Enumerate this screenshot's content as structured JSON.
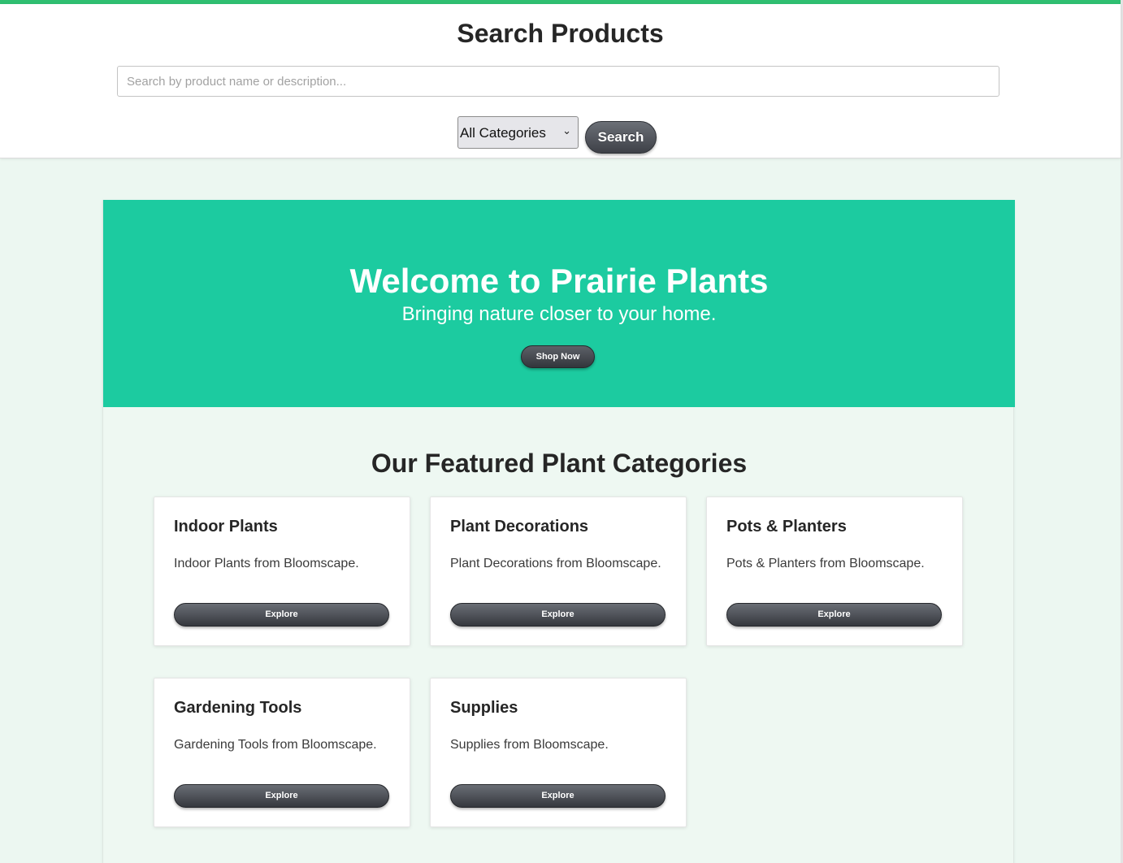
{
  "search": {
    "title": "Search Products",
    "placeholder": "Search by product name or description...",
    "category_selected": "All Categories",
    "button_label": "Search"
  },
  "hero": {
    "title": "Welcome to Prairie Plants",
    "subtitle": "Bringing nature closer to your home.",
    "button_label": "Shop Now"
  },
  "featured": {
    "title": "Our Featured Plant Categories",
    "cards": [
      {
        "title": "Indoor Plants",
        "description": "Indoor Plants from Bloomscape.",
        "button_label": "Explore"
      },
      {
        "title": "Plant Decorations",
        "description": "Plant Decorations from Bloomscape.",
        "button_label": "Explore"
      },
      {
        "title": "Pots & Planters",
        "description": "Pots & Planters from Bloomscape.",
        "button_label": "Explore"
      },
      {
        "title": "Gardening Tools",
        "description": "Gardening Tools from Bloomscape.",
        "button_label": "Explore"
      },
      {
        "title": "Supplies",
        "description": "Supplies from Bloomscape.",
        "button_label": "Explore"
      }
    ]
  },
  "icons": {
    "select_chevron": "chevron-down-icon"
  },
  "colors": {
    "accent": "#2fbf71",
    "hero_background": "#1ccba0",
    "page_background": "#ecf7f1",
    "button_dark": "#3e4148"
  }
}
